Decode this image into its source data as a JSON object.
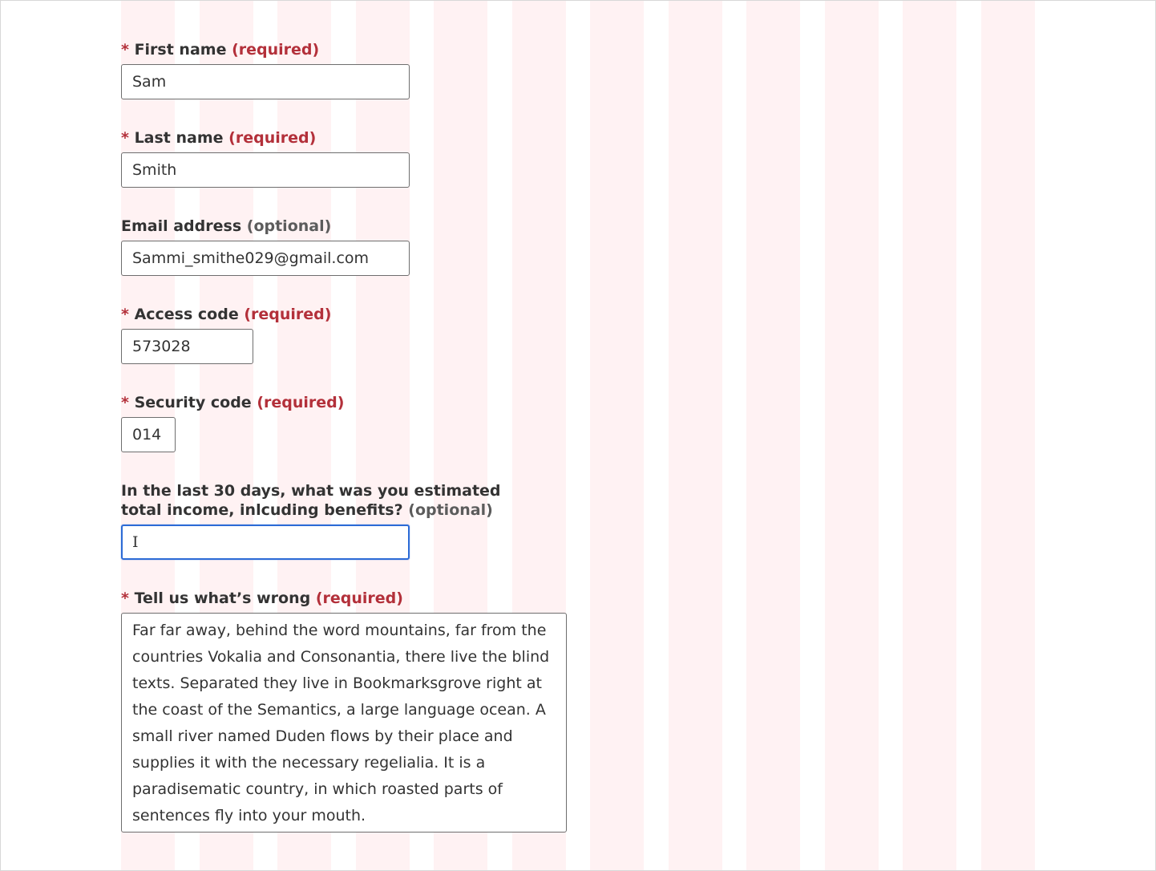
{
  "fields": {
    "first_name": {
      "asterisk": "*",
      "label": "First name",
      "status": "(required)",
      "value": "Sam"
    },
    "last_name": {
      "asterisk": "*",
      "label": "Last name",
      "status": "(required)",
      "value": "Smith"
    },
    "email": {
      "label": "Email address",
      "status": "(optional)",
      "value": "Sammi_smithe029@gmail.com"
    },
    "access_code": {
      "asterisk": "*",
      "label": "Access code",
      "status": "(required)",
      "value": "573028"
    },
    "security_code": {
      "asterisk": "*",
      "label": "Security code",
      "status": "(required)",
      "value": "014"
    },
    "income": {
      "label_line1": "In the last 30 days, what was you estimated",
      "label_line2": "total income, inlcuding benefits?",
      "status": "(optional)",
      "value": "I"
    },
    "whats_wrong": {
      "asterisk": "*",
      "label": "Tell us what’s wrong",
      "status": "(required)",
      "value": "Far far away, behind the word mountains, far from the countries Vokalia and Consonantia, there live the blind texts. Separated they live in Bookmarksgrove right at the coast of the Semantics, a large language ocean. A small river named Duden flows by their place and supplies it with the necessary regelialia. It is a paradisematic country, in which roasted parts of sentences fly into your mouth."
    }
  },
  "colors": {
    "required": "#b3303a",
    "optional": "#5c5c5c",
    "focus": "#2d6bd6",
    "grid_column": "#fff2f3"
  }
}
